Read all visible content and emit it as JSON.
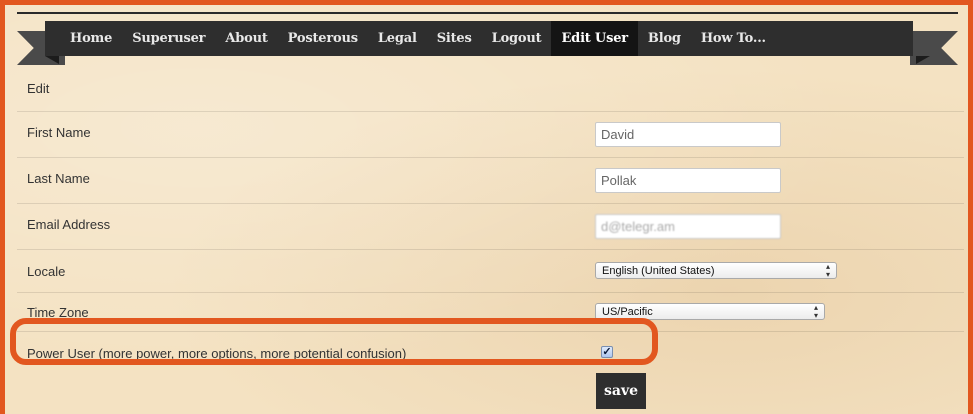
{
  "nav": {
    "items": [
      {
        "label": "Home"
      },
      {
        "label": "Superuser"
      },
      {
        "label": "About"
      },
      {
        "label": "Posterous"
      },
      {
        "label": "Legal"
      },
      {
        "label": "Sites"
      },
      {
        "label": "Logout"
      },
      {
        "label": "Edit User"
      },
      {
        "label": "Blog"
      },
      {
        "label": "How To..."
      }
    ],
    "active": "Edit User"
  },
  "form": {
    "heading": "Edit",
    "first_name": {
      "label": "First Name",
      "value": "David"
    },
    "last_name": {
      "label": "Last Name",
      "value": "Pollak"
    },
    "email": {
      "label": "Email Address",
      "value": "d@telegr.am"
    },
    "locale": {
      "label": "Locale",
      "value": "English (United States)"
    },
    "time_zone": {
      "label": "Time Zone",
      "value": "US/Pacific"
    },
    "power_user": {
      "label": "Power User (more power, more options, more potential confusion)",
      "checked": true
    },
    "save_label": "save"
  },
  "colors": {
    "frame": "#e2571f",
    "nav_bg": "#2e2e2e",
    "nav_active_bg": "#141414",
    "page_bg": "#f4e2c2"
  }
}
